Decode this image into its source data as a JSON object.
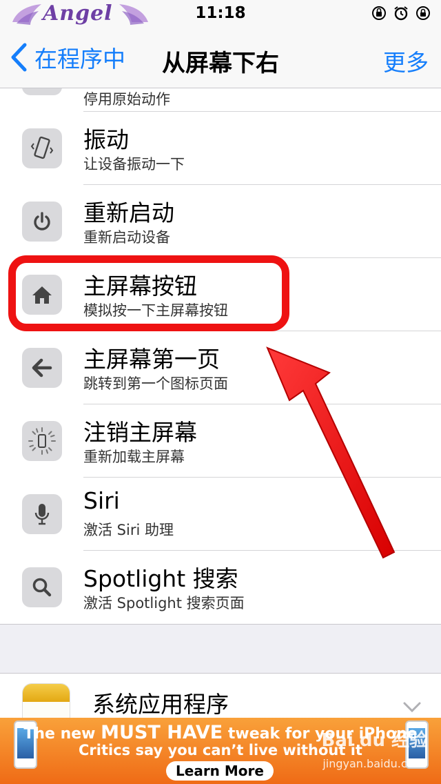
{
  "status_bar": {
    "carrier": "Angel",
    "time": "11:18",
    "icons": [
      "rotation-lock-icon",
      "alarm-icon",
      "lock-icon"
    ]
  },
  "nav": {
    "back_label": "在程序中",
    "title": "从屏幕下右",
    "more_label": "更多"
  },
  "items": [
    {
      "title": "",
      "subtitle": "停用原始动作",
      "icon": "partial-icon"
    },
    {
      "title": "振动",
      "subtitle": "让设备振动一下",
      "icon": "vibrate-icon"
    },
    {
      "title": "重新启动",
      "subtitle": "重新启动设备",
      "icon": "power-icon"
    },
    {
      "title": "主屏幕按钮",
      "subtitle": "模拟按一下主屏幕按钮",
      "icon": "home-icon"
    },
    {
      "title": "主屏幕第一页",
      "subtitle": "跳转到第一个图标页面",
      "icon": "back-arrow-icon"
    },
    {
      "title": "注销主屏幕",
      "subtitle": "重新加载主屏幕",
      "icon": "respring-icon"
    },
    {
      "title": "Siri",
      "subtitle": "激活 Siri 助理",
      "icon": "microphone-icon"
    },
    {
      "title": "Spotlight 搜索",
      "subtitle": "激活 Spotlight 搜索页面",
      "icon": "search-icon"
    }
  ],
  "app_section": {
    "title": "系统应用程序",
    "icon": "notes-app-icon"
  },
  "ad": {
    "line1_prefix": "The new",
    "line1_bold": "MUST HAVE",
    "line1_suffix": "tweak for your iPhone",
    "line2": "Critics say you can’t live without it",
    "button": "Learn More"
  },
  "watermark": {
    "brand": "Bai du 经验",
    "url": "jingyan.baidu.com"
  },
  "colors": {
    "accent": "#157efb",
    "highlight": "#ee1212",
    "ad": "#f4882a"
  }
}
